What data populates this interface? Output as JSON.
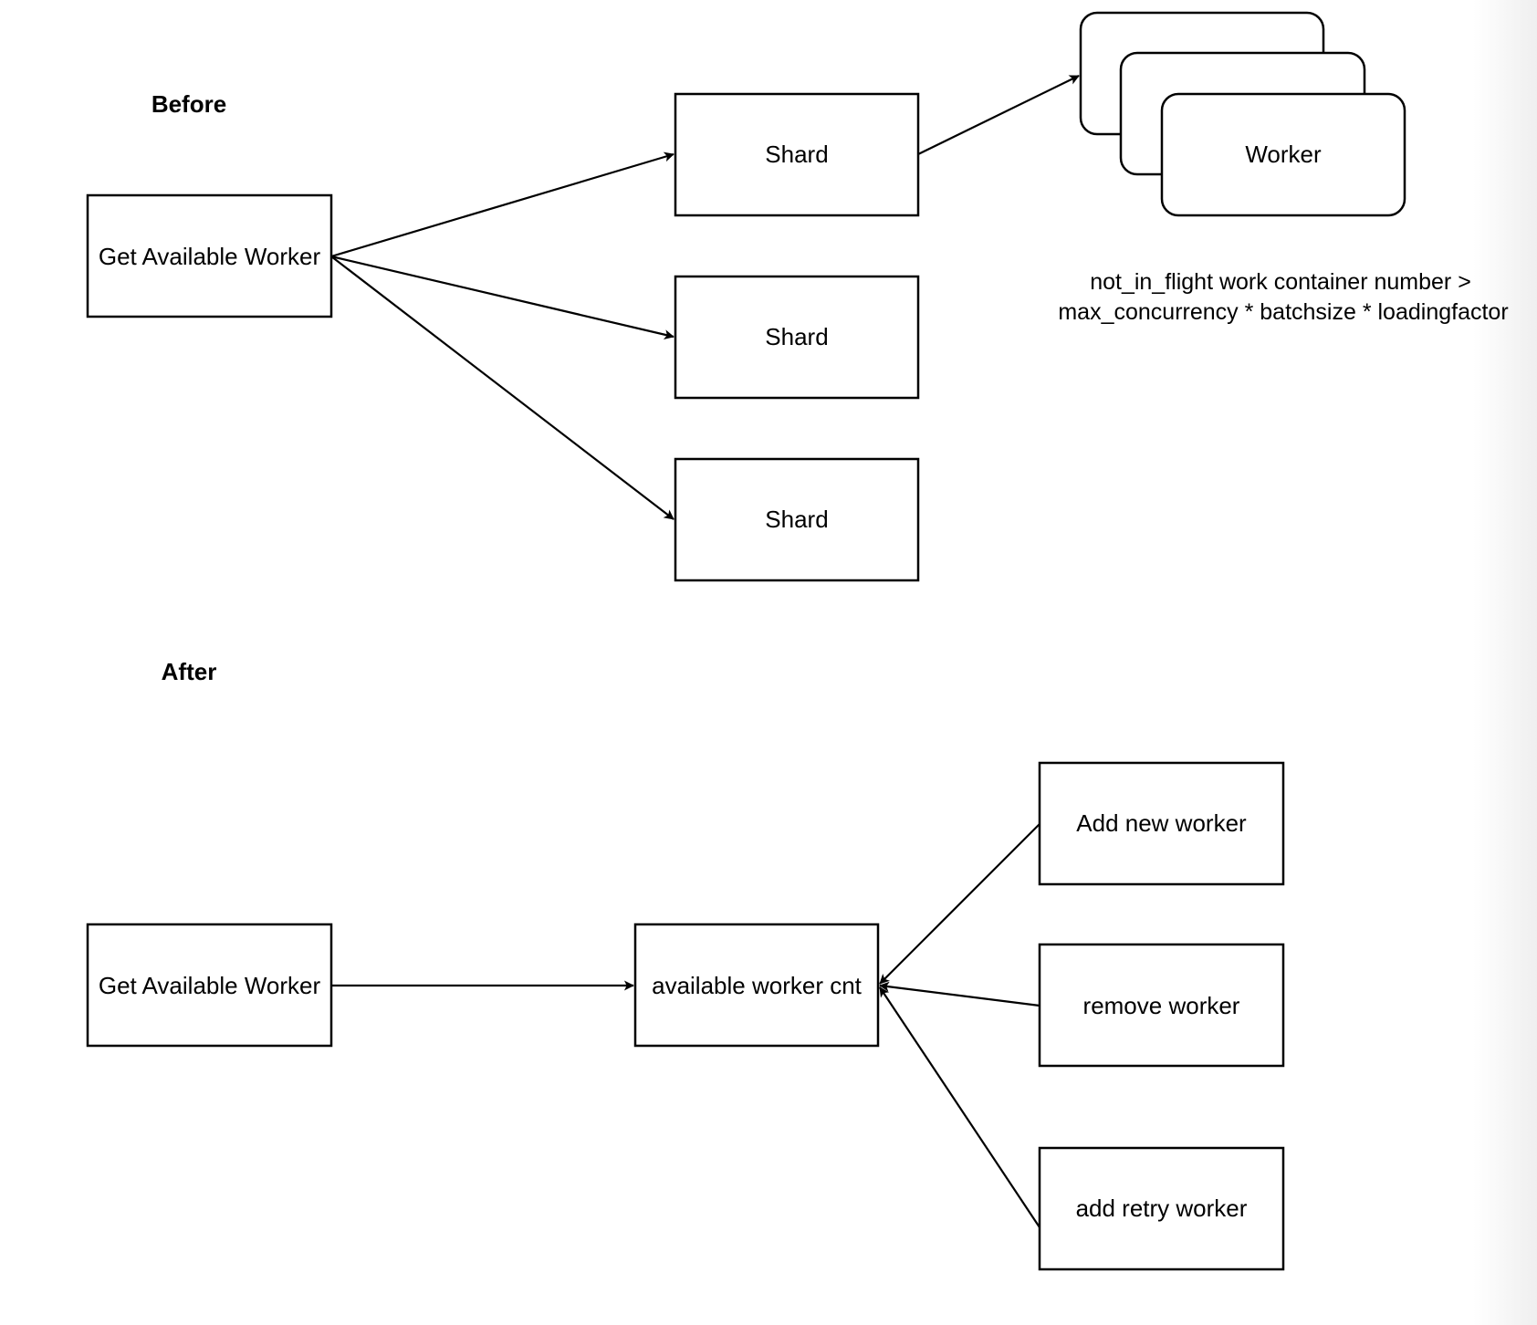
{
  "sections": {
    "before": {
      "label": "Before",
      "source": "Get Available Worker",
      "shards": [
        "Shard",
        "Shard",
        "Shard"
      ],
      "worker": "Worker",
      "note": {
        "line1": "not_in_flight work container number >",
        "line2": "max_concurrency * batchsize * loadingfactor"
      }
    },
    "after": {
      "label": "After",
      "source": "Get Available Worker",
      "counter": "available worker cnt",
      "inputs": [
        "Add new worker",
        "remove worker",
        "add retry worker"
      ]
    }
  },
  "colors": {
    "stroke": "#000000",
    "fill": "#ffffff",
    "text": "#000000"
  }
}
